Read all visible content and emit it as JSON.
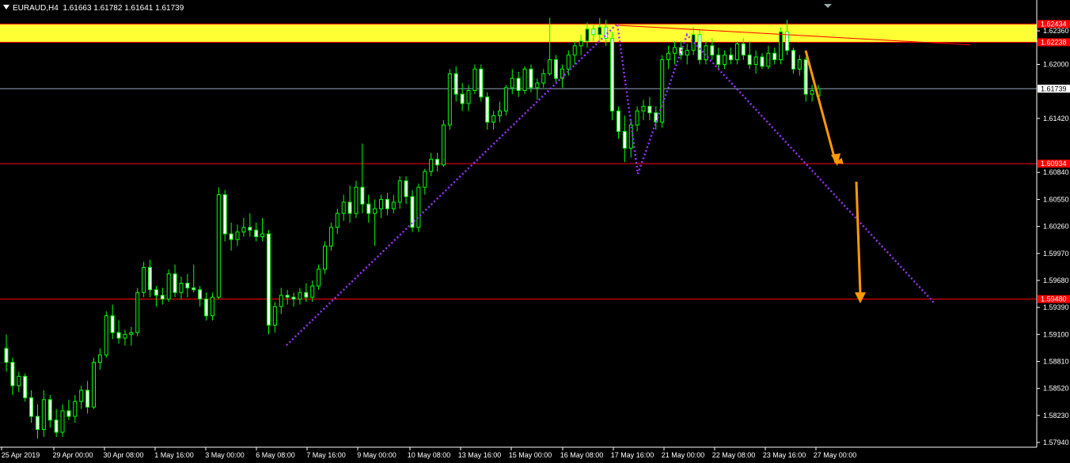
{
  "header": {
    "symbol": "EURAUD,H4",
    "ohlc": "1.61663 1.61782 1.61641 1.61739"
  },
  "chart_data": {
    "type": "candlestick",
    "symbol": "EURAUD",
    "timeframe": "H4",
    "ylim": [
      1.578,
      1.626
    ],
    "y_ticks": [
      "1.62360",
      "1.62250",
      "1.62000",
      "1.61420",
      "1.60840",
      "1.60550",
      "1.60260",
      "1.59970",
      "1.59680",
      "1.59390",
      "1.59100",
      "1.58810",
      "1.58520",
      "1.58230",
      "1.57940"
    ],
    "x_labels": [
      "25 Apr 2019",
      "29 Apr 00:00",
      "30 Apr 08:00",
      "1 May 16:00",
      "3 May 00:00",
      "6 May 08:00",
      "7 May 16:00",
      "9 May 00:00",
      "10 May 08:00",
      "13 May 16:00",
      "15 May 00:00",
      "16 May 08:00",
      "17 May 16:00",
      "21 May 00:00",
      "22 May 08:00",
      "23 May 16:00",
      "27 May 00:00"
    ],
    "price_tags": [
      {
        "label": "1.62434",
        "value": 1.62434,
        "color": "#ff0000"
      },
      {
        "label": "1.62238",
        "value": 1.62238,
        "color": "#ff0000"
      },
      {
        "label": "1.61739",
        "value": 1.61739,
        "color": "#ffffff"
      },
      {
        "label": "1.60934",
        "value": 1.60934,
        "color": "#ff0000"
      },
      {
        "label": "1.59480",
        "value": 1.5948,
        "color": "#ff0000"
      }
    ],
    "resistance_zone": {
      "from": 1.62238,
      "to": 1.62434,
      "color": "#ffff33"
    },
    "horizontal_lines": [
      1.60934,
      1.5948
    ],
    "current_price_line": 1.61739,
    "trendline": {
      "from_index": 0,
      "to_index": 24,
      "from_price": 1.6242,
      "to_price": 1.6221
    },
    "colors": {
      "bull": "#00ff00",
      "bear_body": "#ffffff",
      "line": "#ff0000",
      "pattern": "#9933ff",
      "arrow": "#ff9900"
    },
    "candles": [
      [
        1.5895,
        1.591,
        1.587,
        1.588
      ],
      [
        1.588,
        1.5885,
        1.5845,
        1.5855
      ],
      [
        1.5855,
        1.587,
        1.5848,
        1.5865
      ],
      [
        1.5865,
        1.5868,
        1.5838,
        1.5842
      ],
      [
        1.5842,
        1.585,
        1.5815,
        1.5822
      ],
      [
        1.5822,
        1.5835,
        1.5798,
        1.5808
      ],
      [
        1.5808,
        1.585,
        1.58,
        1.584
      ],
      [
        1.584,
        1.5845,
        1.581,
        1.5818
      ],
      [
        1.5818,
        1.583,
        1.58,
        1.5805
      ],
      [
        1.5805,
        1.5835,
        1.58,
        1.5828
      ],
      [
        1.5828,
        1.584,
        1.5818,
        1.5822
      ],
      [
        1.5822,
        1.5845,
        1.5815,
        1.5838
      ],
      [
        1.5838,
        1.5855,
        1.583,
        1.585
      ],
      [
        1.585,
        1.586,
        1.5825,
        1.5832
      ],
      [
        1.5832,
        1.5885,
        1.583,
        1.588
      ],
      [
        1.588,
        1.5895,
        1.5872,
        1.5888
      ],
      [
        1.5888,
        1.5935,
        1.5885,
        1.593
      ],
      [
        1.593,
        1.5942,
        1.5905,
        1.5912
      ],
      [
        1.5912,
        1.5925,
        1.59,
        1.5906
      ],
      [
        1.5906,
        1.5915,
        1.5898,
        1.591
      ],
      [
        1.591,
        1.5918,
        1.5898,
        1.5912
      ],
      [
        1.5912,
        1.596,
        1.5908,
        1.5955
      ],
      [
        1.5955,
        1.5988,
        1.595,
        1.5982
      ],
      [
        1.5982,
        1.599,
        1.595,
        1.5958
      ],
      [
        1.5958,
        1.5962,
        1.594,
        1.5952
      ],
      [
        1.5952,
        1.596,
        1.5942,
        1.5948
      ],
      [
        1.5948,
        1.598,
        1.5945,
        1.5975
      ],
      [
        1.5975,
        1.5985,
        1.595,
        1.5955
      ],
      [
        1.5955,
        1.5972,
        1.5948,
        1.5965
      ],
      [
        1.5965,
        1.5975,
        1.595,
        1.596
      ],
      [
        1.596,
        1.5985,
        1.5955,
        1.5958
      ],
      [
        1.5958,
        1.5962,
        1.594,
        1.5948
      ],
      [
        1.5948,
        1.5955,
        1.5925,
        1.593
      ],
      [
        1.593,
        1.5955,
        1.5925,
        1.595
      ],
      [
        1.595,
        1.6068,
        1.5948,
        1.606
      ],
      [
        1.606,
        1.6065,
        1.601,
        1.6018
      ],
      [
        1.6018,
        1.603,
        1.6,
        1.6012
      ],
      [
        1.6012,
        1.6028,
        1.6005,
        1.602
      ],
      [
        1.602,
        1.6035,
        1.6015,
        1.6025
      ],
      [
        1.6025,
        1.604,
        1.6015,
        1.6022
      ],
      [
        1.6022,
        1.603,
        1.601,
        1.6015
      ],
      [
        1.6015,
        1.6035,
        1.601,
        1.6018
      ],
      [
        1.6018,
        1.6022,
        1.591,
        1.592
      ],
      [
        1.592,
        1.5945,
        1.5912,
        1.594
      ],
      [
        1.594,
        1.596,
        1.5932,
        1.5952
      ],
      [
        1.5952,
        1.5958,
        1.5942,
        1.595
      ],
      [
        1.595,
        1.5955,
        1.594,
        1.5948
      ],
      [
        1.5948,
        1.596,
        1.5942,
        1.5955
      ],
      [
        1.5955,
        1.5965,
        1.5945,
        1.595
      ],
      [
        1.595,
        1.5968,
        1.5945,
        1.5962
      ],
      [
        1.5962,
        1.5985,
        1.5958,
        1.598
      ],
      [
        1.598,
        1.601,
        1.5975,
        1.6005
      ],
      [
        1.6005,
        1.603,
        1.6,
        1.6025
      ],
      [
        1.6025,
        1.6045,
        1.6018,
        1.604
      ],
      [
        1.604,
        1.606,
        1.6032,
        1.6052
      ],
      [
        1.6052,
        1.607,
        1.603,
        1.604
      ],
      [
        1.604,
        1.6075,
        1.6035,
        1.6068
      ],
      [
        1.6068,
        1.6115,
        1.604,
        1.605
      ],
      [
        1.605,
        1.606,
        1.603,
        1.604
      ],
      [
        1.604,
        1.6055,
        1.6005,
        1.6045
      ],
      [
        1.6045,
        1.606,
        1.6035,
        1.6055
      ],
      [
        1.6055,
        1.6062,
        1.6038,
        1.6045
      ],
      [
        1.6045,
        1.606,
        1.604,
        1.6052
      ],
      [
        1.6052,
        1.608,
        1.6045,
        1.6075
      ],
      [
        1.6075,
        1.608,
        1.605,
        1.6058
      ],
      [
        1.6058,
        1.6065,
        1.602,
        1.6025
      ],
      [
        1.6025,
        1.6072,
        1.602,
        1.6068
      ],
      [
        1.6068,
        1.6088,
        1.606,
        1.6085
      ],
      [
        1.6085,
        1.6105,
        1.608,
        1.6098
      ],
      [
        1.6098,
        1.6105,
        1.6085,
        1.6092
      ],
      [
        1.6092,
        1.614,
        1.609,
        1.6135
      ],
      [
        1.6135,
        1.6195,
        1.613,
        1.619
      ],
      [
        1.619,
        1.6198,
        1.616,
        1.6168
      ],
      [
        1.6168,
        1.618,
        1.615,
        1.6158
      ],
      [
        1.6158,
        1.6178,
        1.615,
        1.6172
      ],
      [
        1.6172,
        1.62,
        1.6168,
        1.6195
      ],
      [
        1.6195,
        1.62,
        1.616,
        1.6165
      ],
      [
        1.6165,
        1.617,
        1.613,
        1.6138
      ],
      [
        1.6138,
        1.615,
        1.613,
        1.6145
      ],
      [
        1.6145,
        1.616,
        1.6138,
        1.615
      ],
      [
        1.615,
        1.6178,
        1.6145,
        1.6175
      ],
      [
        1.6175,
        1.6195,
        1.6168,
        1.6185
      ],
      [
        1.6185,
        1.6192,
        1.6165,
        1.6172
      ],
      [
        1.6172,
        1.6198,
        1.6168,
        1.6195
      ],
      [
        1.6195,
        1.62,
        1.617,
        1.6175
      ],
      [
        1.6175,
        1.6185,
        1.6162,
        1.618
      ],
      [
        1.618,
        1.6195,
        1.6175,
        1.619
      ],
      [
        1.619,
        1.625,
        1.6188,
        1.6205
      ],
      [
        1.6205,
        1.621,
        1.618,
        1.6185
      ],
      [
        1.6185,
        1.62,
        1.6175,
        1.6195
      ],
      [
        1.6195,
        1.6215,
        1.6188,
        1.621
      ],
      [
        1.621,
        1.6225,
        1.62,
        1.622
      ],
      [
        1.622,
        1.6232,
        1.621,
        1.6225
      ],
      [
        1.6225,
        1.6245,
        1.6218,
        1.6238
      ],
      [
        1.6238,
        1.6242,
        1.6225,
        1.6232
      ],
      [
        1.6232,
        1.625,
        1.6225,
        1.624
      ],
      [
        1.624,
        1.6248,
        1.622,
        1.6228
      ],
      [
        1.6228,
        1.6235,
        1.614,
        1.615
      ],
      [
        1.615,
        1.6155,
        1.612,
        1.6128
      ],
      [
        1.6128,
        1.6145,
        1.6095,
        1.611
      ],
      [
        1.611,
        1.614,
        1.61,
        1.6135
      ],
      [
        1.6135,
        1.6155,
        1.6128,
        1.615
      ],
      [
        1.615,
        1.6162,
        1.614,
        1.6155
      ],
      [
        1.6155,
        1.6165,
        1.614,
        1.6148
      ],
      [
        1.6148,
        1.6155,
        1.613,
        1.6138
      ],
      [
        1.6138,
        1.621,
        1.6132,
        1.6205
      ],
      [
        1.6205,
        1.622,
        1.6195,
        1.6212
      ],
      [
        1.6212,
        1.6225,
        1.62,
        1.6218
      ],
      [
        1.6218,
        1.6225,
        1.6205,
        1.621
      ],
      [
        1.621,
        1.6222,
        1.62,
        1.6215
      ],
      [
        1.6215,
        1.624,
        1.621,
        1.6232
      ],
      [
        1.6232,
        1.6238,
        1.62,
        1.6205
      ],
      [
        1.6205,
        1.6225,
        1.62,
        1.622
      ],
      [
        1.622,
        1.6228,
        1.6205,
        1.621
      ],
      [
        1.621,
        1.6218,
        1.6195,
        1.62
      ],
      [
        1.62,
        1.6215,
        1.6195,
        1.621
      ],
      [
        1.621,
        1.6218,
        1.62,
        1.6205
      ],
      [
        1.6205,
        1.6225,
        1.62,
        1.6222
      ],
      [
        1.6222,
        1.6228,
        1.6205,
        1.621
      ],
      [
        1.621,
        1.6225,
        1.6195,
        1.62
      ],
      [
        1.62,
        1.6215,
        1.619,
        1.6208
      ],
      [
        1.6208,
        1.6212,
        1.6195,
        1.6198
      ],
      [
        1.6198,
        1.622,
        1.6195,
        1.6212
      ],
      [
        1.6212,
        1.6218,
        1.62,
        1.6205
      ],
      [
        1.6205,
        1.624,
        1.62,
        1.6235
      ],
      [
        1.6235,
        1.6248,
        1.621,
        1.6215
      ],
      [
        1.6215,
        1.6218,
        1.619,
        1.6195
      ],
      [
        1.6195,
        1.621,
        1.6188,
        1.6205
      ],
      [
        1.6205,
        1.6208,
        1.616,
        1.6168
      ],
      [
        1.6168,
        1.6178,
        1.616,
        1.6172
      ],
      [
        1.6166,
        1.6178,
        1.6164,
        1.6174
      ]
    ]
  }
}
